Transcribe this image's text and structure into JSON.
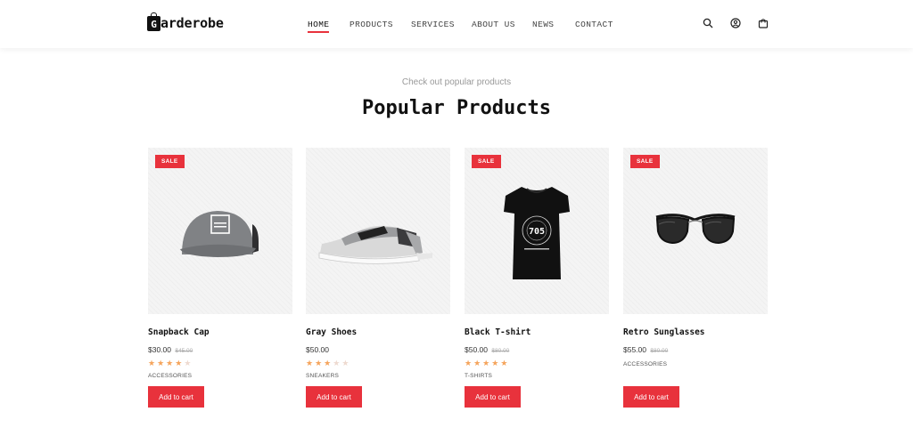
{
  "brand": {
    "logo_letter": "G",
    "name": "arderobe"
  },
  "nav": [
    {
      "label": "HOME",
      "active": true
    },
    {
      "label": "PRODUCTS"
    },
    {
      "label": "SERVICES"
    },
    {
      "label": "ABOUT US"
    },
    {
      "label": "NEWS"
    },
    {
      "label": "CONTACT"
    }
  ],
  "header_icons": [
    "search-icon",
    "user-icon",
    "cart-icon"
  ],
  "section": {
    "subtitle": "Check out popular products",
    "title": "Popular Products"
  },
  "products": [
    {
      "name": "Snapback Cap",
      "price": "$30.00",
      "old_price": "$45.00",
      "rating": 4,
      "category": "ACCESSORIES",
      "sale": "SALE",
      "button": "Add to cart"
    },
    {
      "name": "Gray Shoes",
      "price": "$50.00",
      "old_price": "",
      "rating": 3,
      "category": "SNEAKERS",
      "sale": "",
      "button": "Add to cart"
    },
    {
      "name": "Black T-shirt",
      "price": "$50.00",
      "old_price": "$80.00",
      "rating": 5,
      "category": "T-SHIRTS",
      "sale": "SALE",
      "button": "Add to cart"
    },
    {
      "name": "Retro Sunglasses",
      "price": "$55.00",
      "old_price": "$80.00",
      "rating": 0,
      "category": "ACCESSORIES",
      "sale": "SALE",
      "button": "Add to cart"
    }
  ],
  "colors": {
    "accent": "#e8323c",
    "star": "#f5a45b",
    "text": "#111111"
  }
}
